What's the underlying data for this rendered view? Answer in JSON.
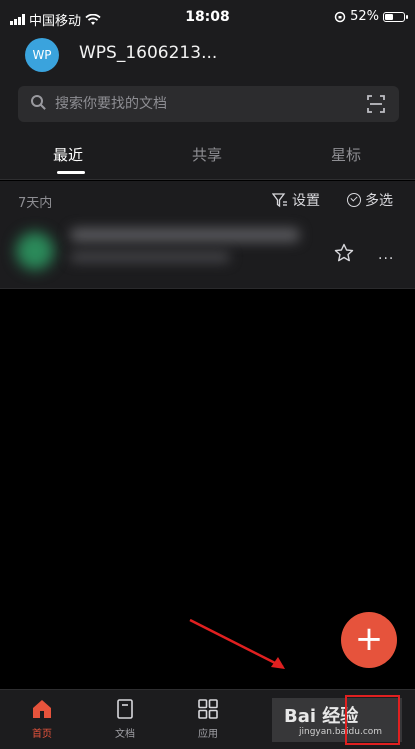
{
  "status_bar": {
    "carrier": "中国移动",
    "time": "18:08",
    "battery": "52%",
    "battery_level": 0.52
  },
  "account": {
    "avatar_text": "WP",
    "name": "WPS_1606213..."
  },
  "search": {
    "placeholder": "搜索你要找的文档"
  },
  "tabs": [
    {
      "label": "最近",
      "active": true
    },
    {
      "label": "共享",
      "active": false
    },
    {
      "label": "星标",
      "active": false
    }
  ],
  "list_header": {
    "section_label": "7天内",
    "settings_label": "设置",
    "multiselect_label": "多选"
  },
  "file_row": {
    "more_label": "···"
  },
  "fab": {
    "label": "+"
  },
  "bottom_nav": [
    {
      "label": "首页",
      "icon": "home-icon",
      "active": true
    },
    {
      "label": "文档",
      "icon": "document-icon",
      "active": false
    },
    {
      "label": "应用",
      "icon": "apps-icon",
      "active": false
    }
  ],
  "watermark": {
    "logo": "Bai 经验",
    "url": "jingyan.baidu.com"
  },
  "colors": {
    "accent": "#e6533c",
    "background": "#000000",
    "surface": "#1c1c1e",
    "highlight_box": "#e02020",
    "avatar": "#3aa3dd"
  }
}
